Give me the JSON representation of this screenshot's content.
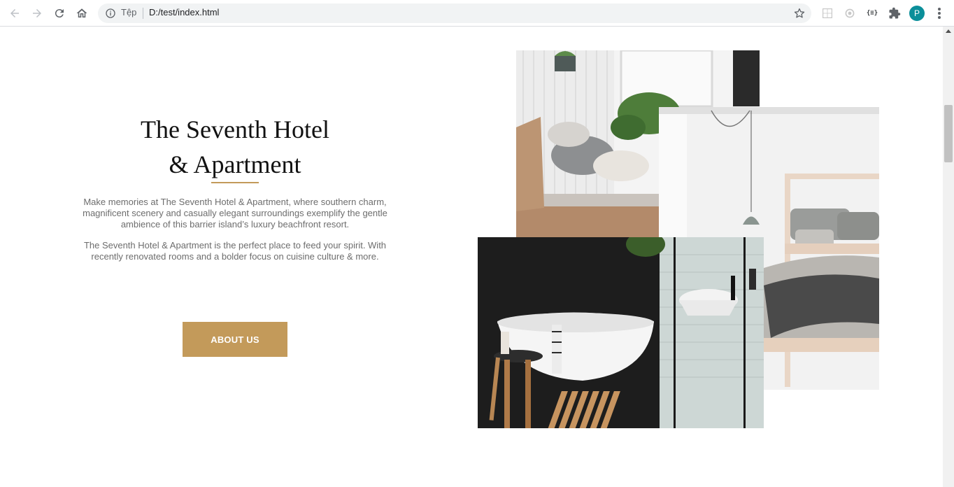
{
  "browser": {
    "site_label": "Tệp",
    "url": "D:/test/index.html",
    "profile_initial": "P",
    "extensions": {
      "code_label": "{≡}"
    }
  },
  "page": {
    "title_line1": "The Seventh Hotel",
    "title_line2": "& Apartment",
    "paragraph1": "Make memories at The Seventh Hotel & Apartment, where southern charm, magnificent scenery and casually elegant surroundings exemplify the gentle ambience of this barrier island’s luxury beachfront resort.",
    "paragraph2": "The Seventh Hotel & Apartment is the perfect place to feed your spirit. With recently renovated rooms and a bolder focus on cuisine culture & more.",
    "about_button": "ABOUT US",
    "accent_color": "#c39a5a"
  }
}
